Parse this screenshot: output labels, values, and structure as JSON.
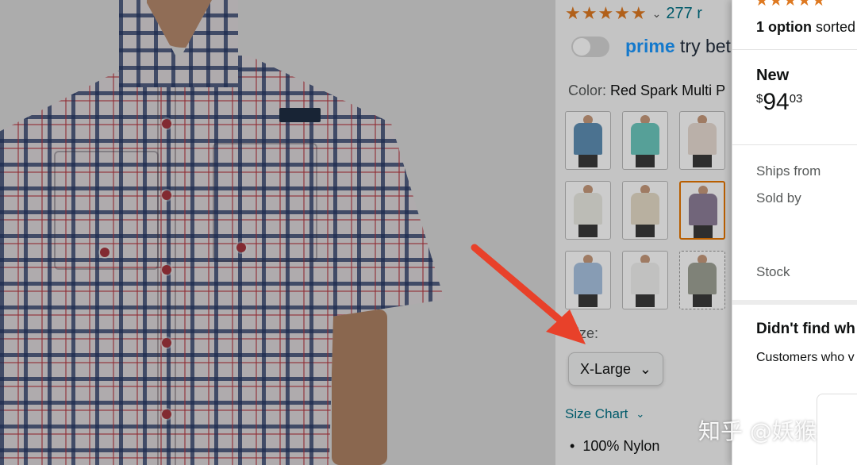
{
  "rating": {
    "stars": "★★★★★",
    "count": "277 r"
  },
  "prime": {
    "brand": "prime",
    "cta": "try bet"
  },
  "color": {
    "label": "Color:",
    "value": "Red Spark Multi P"
  },
  "swatches": [
    {
      "shirt_color": "#5e8fb5"
    },
    {
      "shirt_color": "#6cc9bf"
    },
    {
      "shirt_color": "#e9dcd4"
    },
    {
      "shirt_color": "#ecebe4"
    },
    {
      "shirt_color": "#e6dcc9"
    },
    {
      "shirt_color": "#8e7f99"
    },
    {
      "shirt_color": "#a9c3e2"
    },
    {
      "shirt_color": "#f2f2f0"
    },
    {
      "shirt_color": "#9fa396"
    }
  ],
  "size": {
    "label": "Size:",
    "selected": "X-Large"
  },
  "size_chart": {
    "label": "Size Chart"
  },
  "bullets": [
    "100% Nylon"
  ],
  "buy_panel": {
    "stars": "★★★★★",
    "options_bold": "1 option",
    "options_rest": " sorted",
    "condition": "New",
    "price_symbol": "$",
    "price_whole": "94",
    "price_fraction": "03",
    "ships_from": "Ships from",
    "sold_by": "Sold by",
    "stock": "Stock",
    "didnt_find": "Didn't find wh",
    "customers": "Customers who v"
  },
  "watermark": "知乎 @妖猴",
  "colors": {
    "accent": "#e77600",
    "link": "#007185",
    "star": "#de7921",
    "prime_blue": "#1a98ff",
    "arrow": "#e8412a"
  }
}
